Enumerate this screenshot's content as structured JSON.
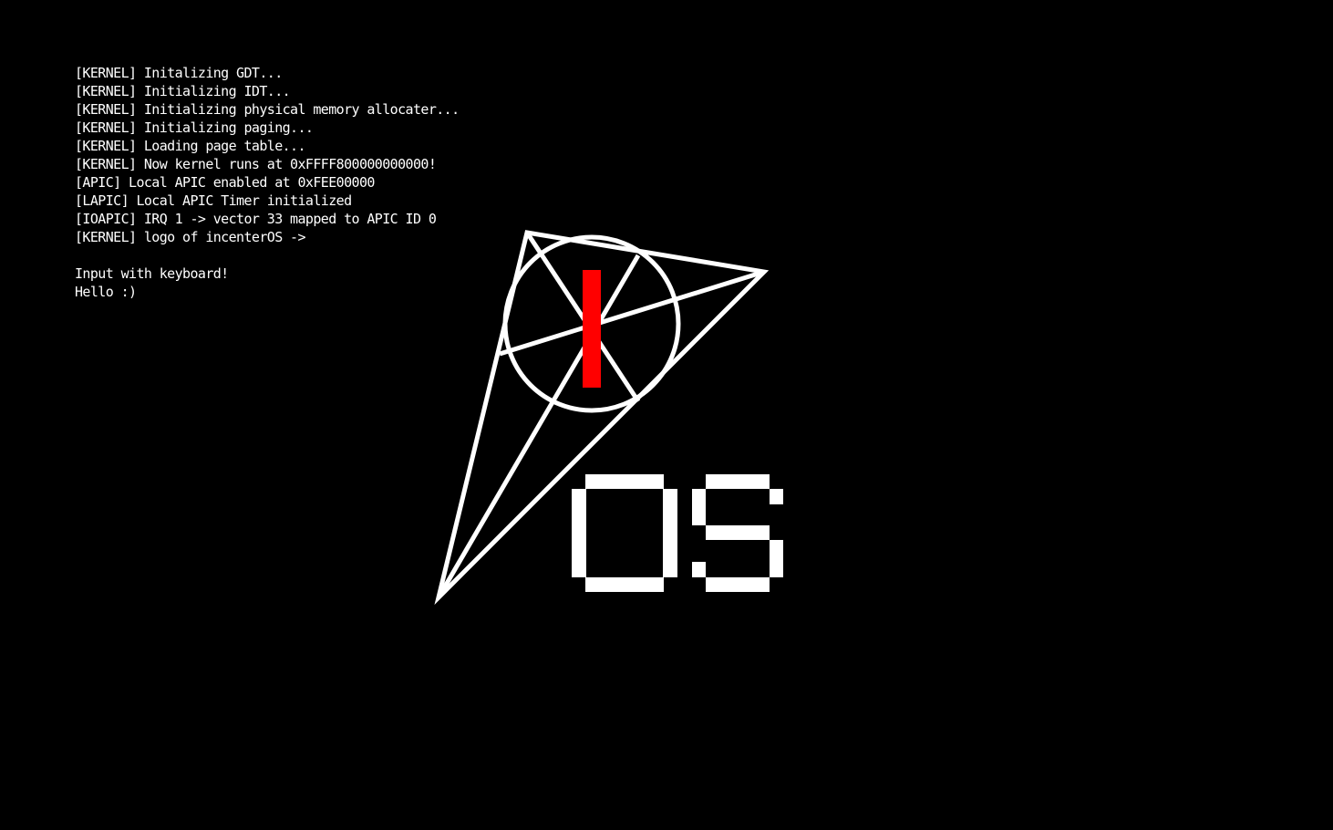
{
  "console": {
    "lines": [
      "[KERNEL] Initalizing GDT...",
      "[KERNEL] Initializing IDT...",
      "[KERNEL] Initializing physical memory allocater...",
      "[KERNEL] Initializing paging...",
      "[KERNEL] Loading page table...",
      "[KERNEL] Now kernel runs at 0xFFFF800000000000!",
      "[APIC] Local APIC enabled at 0xFEE00000",
      "[LAPIC] Local APIC Timer initialized",
      "[IOAPIC] IRQ 1 -> vector 33 mapped to APIC ID 0",
      "[KERNEL] logo of incenterOS ->",
      "",
      "Input with keyboard!",
      "Hello :)"
    ]
  },
  "logo": {
    "icon_name": "incenter-os-logo-icon",
    "letter_i": "I",
    "letters_os": "OS",
    "colors": {
      "background": "#000000",
      "foreground": "#ffffff",
      "accent": "#ff0000"
    }
  }
}
